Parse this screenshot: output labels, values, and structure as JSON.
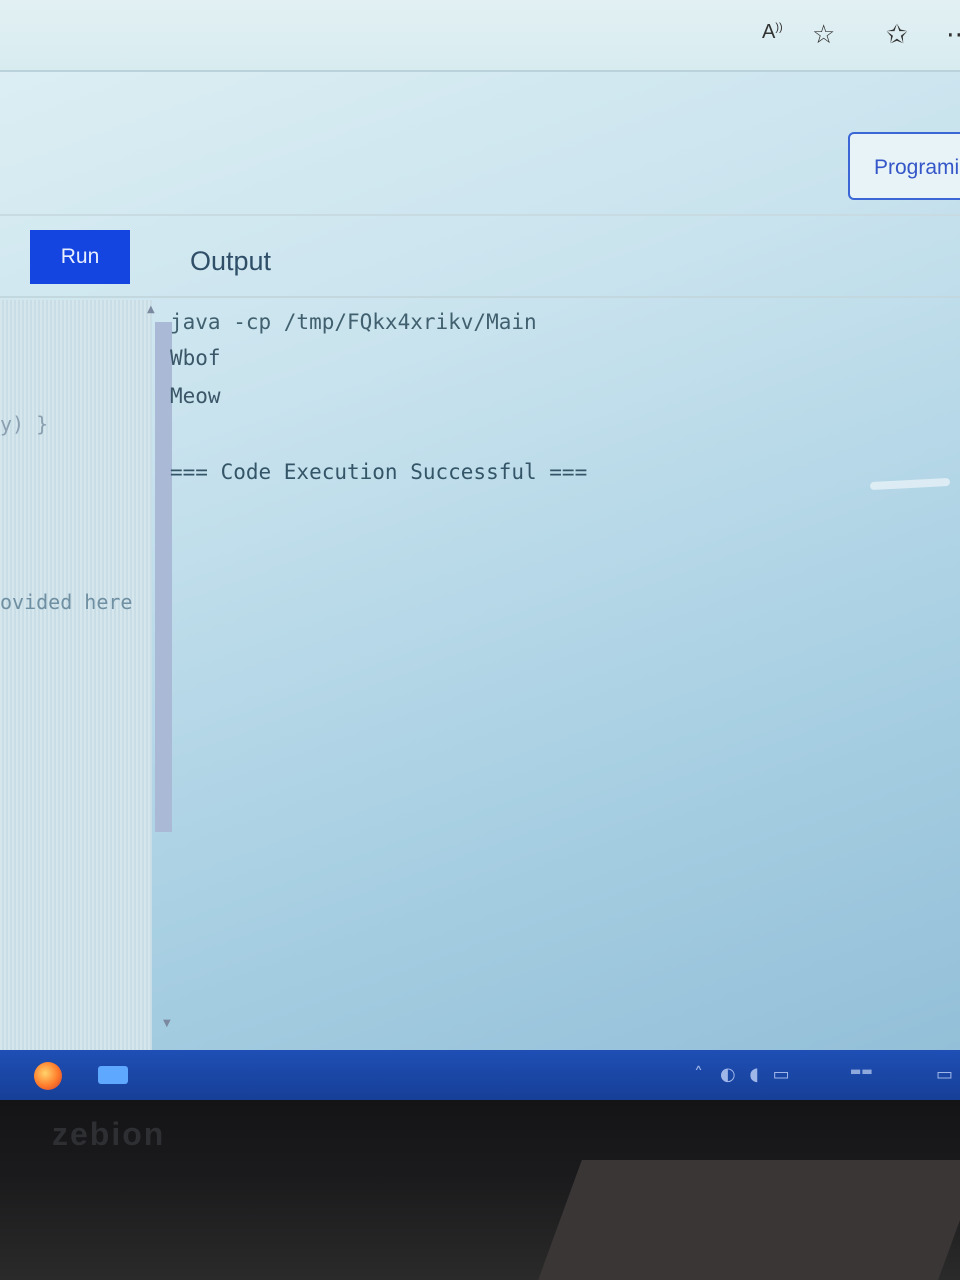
{
  "browser": {
    "icons": {
      "read_aloud": "read-aloud-icon",
      "add_favorite": "add-favorite-icon",
      "favorites": "favorites-icon",
      "more": "more-icon"
    },
    "read_aloud_glyph": "A",
    "read_aloud_sup": "))"
  },
  "header": {
    "site_button_label": "Programiz"
  },
  "editor": {
    "run_label": "Run",
    "output_label": "Output",
    "code_fragments": [
      "y) }",
      "ovided here"
    ]
  },
  "output": {
    "lines": [
      "java -cp /tmp/FQkx4xrikv/Main",
      "Wbof",
      "Meow",
      "=== Code Execution Successful ==="
    ]
  },
  "taskbar": {
    "apps": [
      "firefox-icon",
      "app-icon"
    ]
  },
  "device": {
    "brand": "zebion"
  },
  "colors": {
    "run_button": "#1545e0",
    "taskbar": "#1f4fb5",
    "site_button_border": "#3a66d6"
  }
}
